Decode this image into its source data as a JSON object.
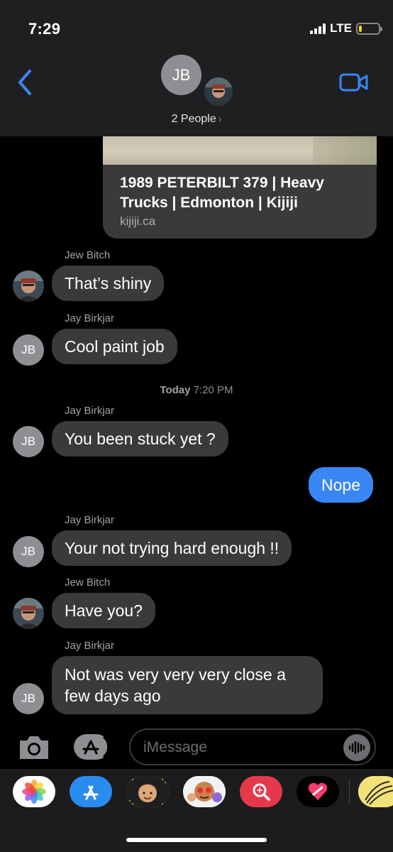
{
  "status_bar": {
    "time": "7:29",
    "network": "LTE",
    "battery_level": 0.15
  },
  "header": {
    "group_initials": "JB",
    "people_label": "2 People",
    "chevron": "›",
    "back_icon": "chevron-left-icon",
    "video_icon": "video-camera-icon",
    "accent_color": "#3a86f5"
  },
  "link_preview": {
    "title": "1989 PETERBILT 379 | Heavy Trucks | Edmonton | Kijiji",
    "domain": "kijiji.ca"
  },
  "messages": [
    {
      "sender": "Jew Bitch",
      "text": "That’s shiny",
      "direction": "incoming",
      "avatar": "photo"
    },
    {
      "sender": "Jay Birkjar",
      "text": "Cool paint job",
      "direction": "incoming",
      "avatar": "JB"
    },
    {
      "sender": "Jay Birkjar",
      "text": "You been stuck yet ?",
      "direction": "incoming",
      "avatar": "JB"
    },
    {
      "sender": "",
      "text": "Nope",
      "direction": "outgoing"
    },
    {
      "sender": "Jay Birkjar",
      "text": "Your not trying hard enough !!",
      "direction": "incoming",
      "avatar": "JB"
    },
    {
      "sender": "Jew Bitch",
      "text": "Have you?",
      "direction": "incoming",
      "avatar": "photo"
    },
    {
      "sender": "Jay Birkjar",
      "text": "Not was very very very close a few days ago",
      "direction": "incoming",
      "avatar": "JB"
    }
  ],
  "timestamp": {
    "day": "Today",
    "time": "7:20 PM"
  },
  "avatar_initials": "JB",
  "input": {
    "placeholder": "iMessage"
  },
  "app_drawer": [
    "photos-app-icon",
    "app-store-icon",
    "memoji-icon",
    "animoji-icon",
    "image-search-icon",
    "digital-touch-icon",
    "partial-app-icon"
  ]
}
